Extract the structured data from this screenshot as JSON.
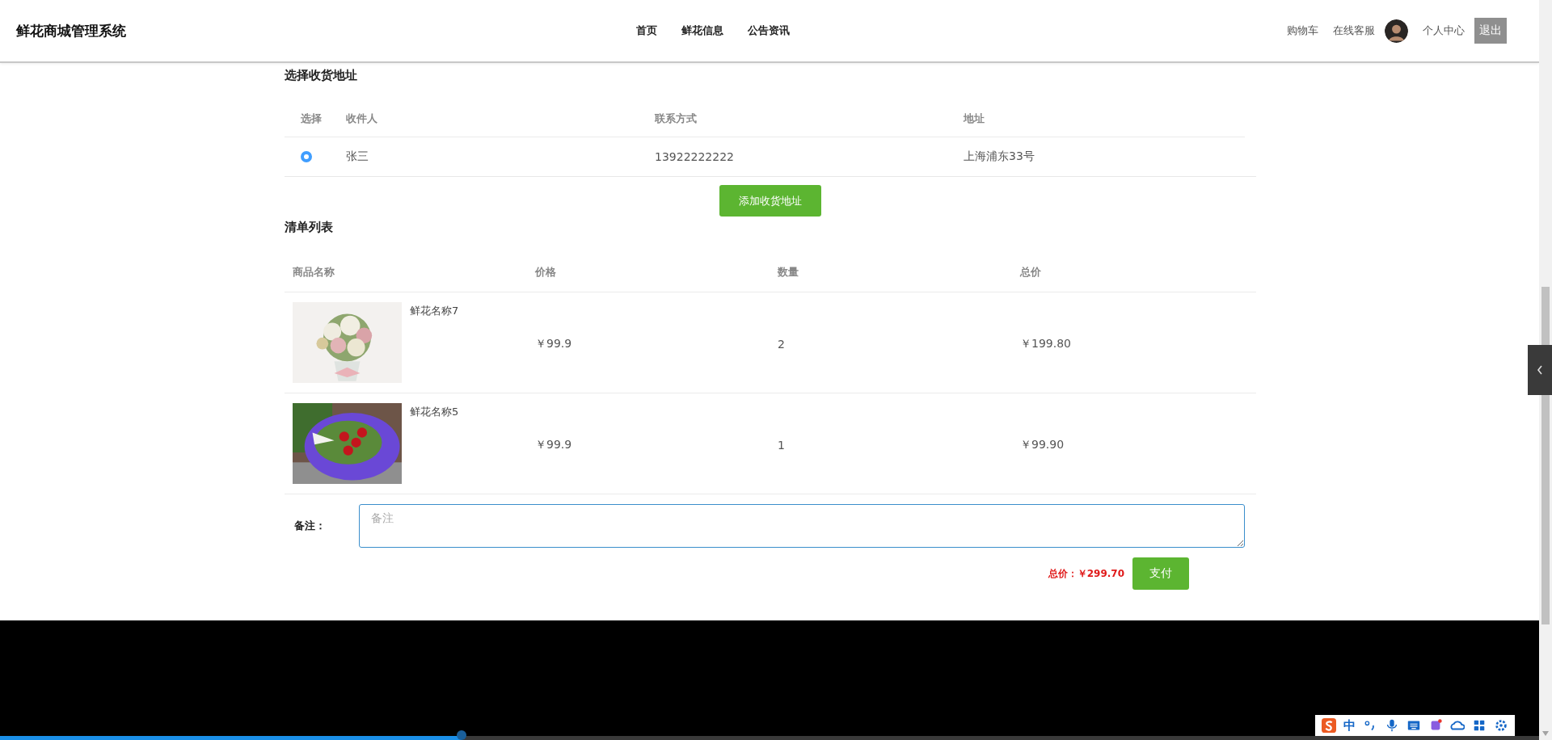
{
  "header": {
    "title": "鲜花商城管理系统",
    "nav": [
      {
        "label": "首页"
      },
      {
        "label": "鲜花信息"
      },
      {
        "label": "公告资讯"
      }
    ],
    "links": [
      {
        "label": "购物车"
      },
      {
        "label": "在线客服"
      }
    ],
    "user_link": "个人中心",
    "logout": "退出"
  },
  "address": {
    "title": "选择收货地址",
    "columns": [
      "选择",
      "收件人",
      "联系方式",
      "地址"
    ],
    "rows": [
      {
        "selected": true,
        "recipient": "张三",
        "phone": "13922222222",
        "address": "上海浦东33号"
      }
    ],
    "add_button": "添加收货地址"
  },
  "order": {
    "title": "清单列表",
    "columns": [
      "商品名称",
      "价格",
      "数量",
      "总价"
    ],
    "rows": [
      {
        "name": "鲜花名称7",
        "price": "￥99.9",
        "quantity": "2",
        "total": "￥199.80"
      },
      {
        "name": "鲜花名称5",
        "price": "￥99.9",
        "quantity": "1",
        "total": "￥99.90"
      }
    ]
  },
  "remark": {
    "label": "备注：",
    "placeholder": "备注"
  },
  "summary": {
    "total": "总价：￥299.70",
    "pay_button": "支付"
  },
  "player": {
    "level": 0.3
  },
  "ime_toolbar": {
    "label": "中"
  }
}
